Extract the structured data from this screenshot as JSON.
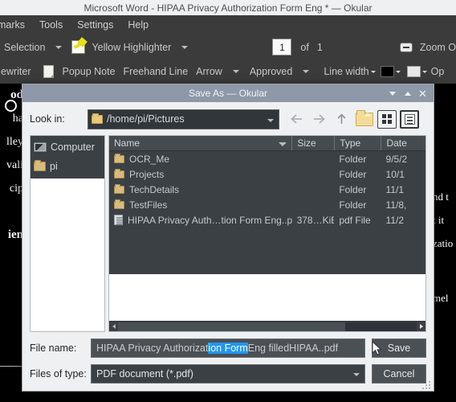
{
  "window": {
    "title": "Microsoft Word - HIPAA Privacy Authorization Form Eng * — Okular"
  },
  "menubar": {
    "items": [
      {
        "label": "marks"
      },
      {
        "label": "Tools"
      },
      {
        "label": "Settings"
      },
      {
        "label": "Help"
      }
    ]
  },
  "toolbar_row1": {
    "selection_label": "Selection",
    "highlighter_label": "Yellow Highlighter",
    "page_number": "1",
    "of_label": "of",
    "page_total": "1",
    "zoom_label": "Zoom O"
  },
  "toolbar_row2": {
    "typewriter_label": "ewriter",
    "popup_note_label": "Popup Note",
    "freehand_line_label": "Freehand Line",
    "arrow_label": "Arrow",
    "approved_label": "Approved",
    "line_width_label": "Line width",
    "opacity_label": "Op",
    "line_color": "#000000",
    "fill_color": "#e8e8e8"
  },
  "document": {
    "left_fragments": [
      "od",
      "ha",
      "lley",
      "vali",
      "cip",
      "ien"
    ],
    "right_fragments": [
      "nd t",
      "t it ",
      "zatio",
      "mel"
    ]
  },
  "dialog": {
    "title": "Save As — Okular",
    "titlebar_buttons": [
      "minimize",
      "maximize",
      "close"
    ],
    "lookin": {
      "label": "Look in:",
      "value": "/home/pi/Pictures"
    },
    "nav": {
      "back": "back-arrow",
      "forward": "forward-arrow",
      "parent": "up-arrow",
      "new_folder": "new-folder",
      "list_view": "list-view",
      "detail_view": "detail-view"
    },
    "sidebar": {
      "items": [
        {
          "label": "Computer",
          "icon": "computer-icon"
        },
        {
          "label": "pi",
          "icon": "folder-icon"
        }
      ]
    },
    "filelist": {
      "columns": [
        "Name",
        "Size",
        "Type",
        "Date"
      ],
      "sorted_column": "Name",
      "rows": [
        {
          "name": "OCR_Me",
          "size": "",
          "type": "Folder",
          "date": "9/5/2",
          "icon": "folder-icon"
        },
        {
          "name": "Projects",
          "size": "",
          "type": "Folder",
          "date": "10/1",
          "icon": "folder-icon"
        },
        {
          "name": "TechDetails",
          "size": "",
          "type": "Folder",
          "date": "11/1",
          "icon": "folder-icon"
        },
        {
          "name": "TestFiles",
          "size": "",
          "type": "Folder",
          "date": "11/8,",
          "icon": "folder-icon"
        },
        {
          "name": "HIPAA Privacy Auth…tion Form Eng..pdf",
          "size": "378…KiB",
          "type": "pdf File",
          "date": "11/2",
          "icon": "pdf-file-icon"
        }
      ]
    },
    "filename": {
      "label": "File name:",
      "value_before": "HIPAA Privacy Authorizat",
      "value_selected": "ion Form",
      "value_after": " Eng filledHIPAA..pdf",
      "selection_color": "#2196f3"
    },
    "filetype": {
      "label": "Files of type:",
      "value": "PDF document (*.pdf)"
    },
    "buttons": {
      "save": "Save",
      "cancel": "Cancel"
    }
  },
  "colors": {
    "window_chrome": "#3b3b3b",
    "dialog_bg": "#eff0f1",
    "dialog_titlebar": "#8d99a8",
    "field_bg": "#3b4045",
    "accent": "#2196f3"
  }
}
